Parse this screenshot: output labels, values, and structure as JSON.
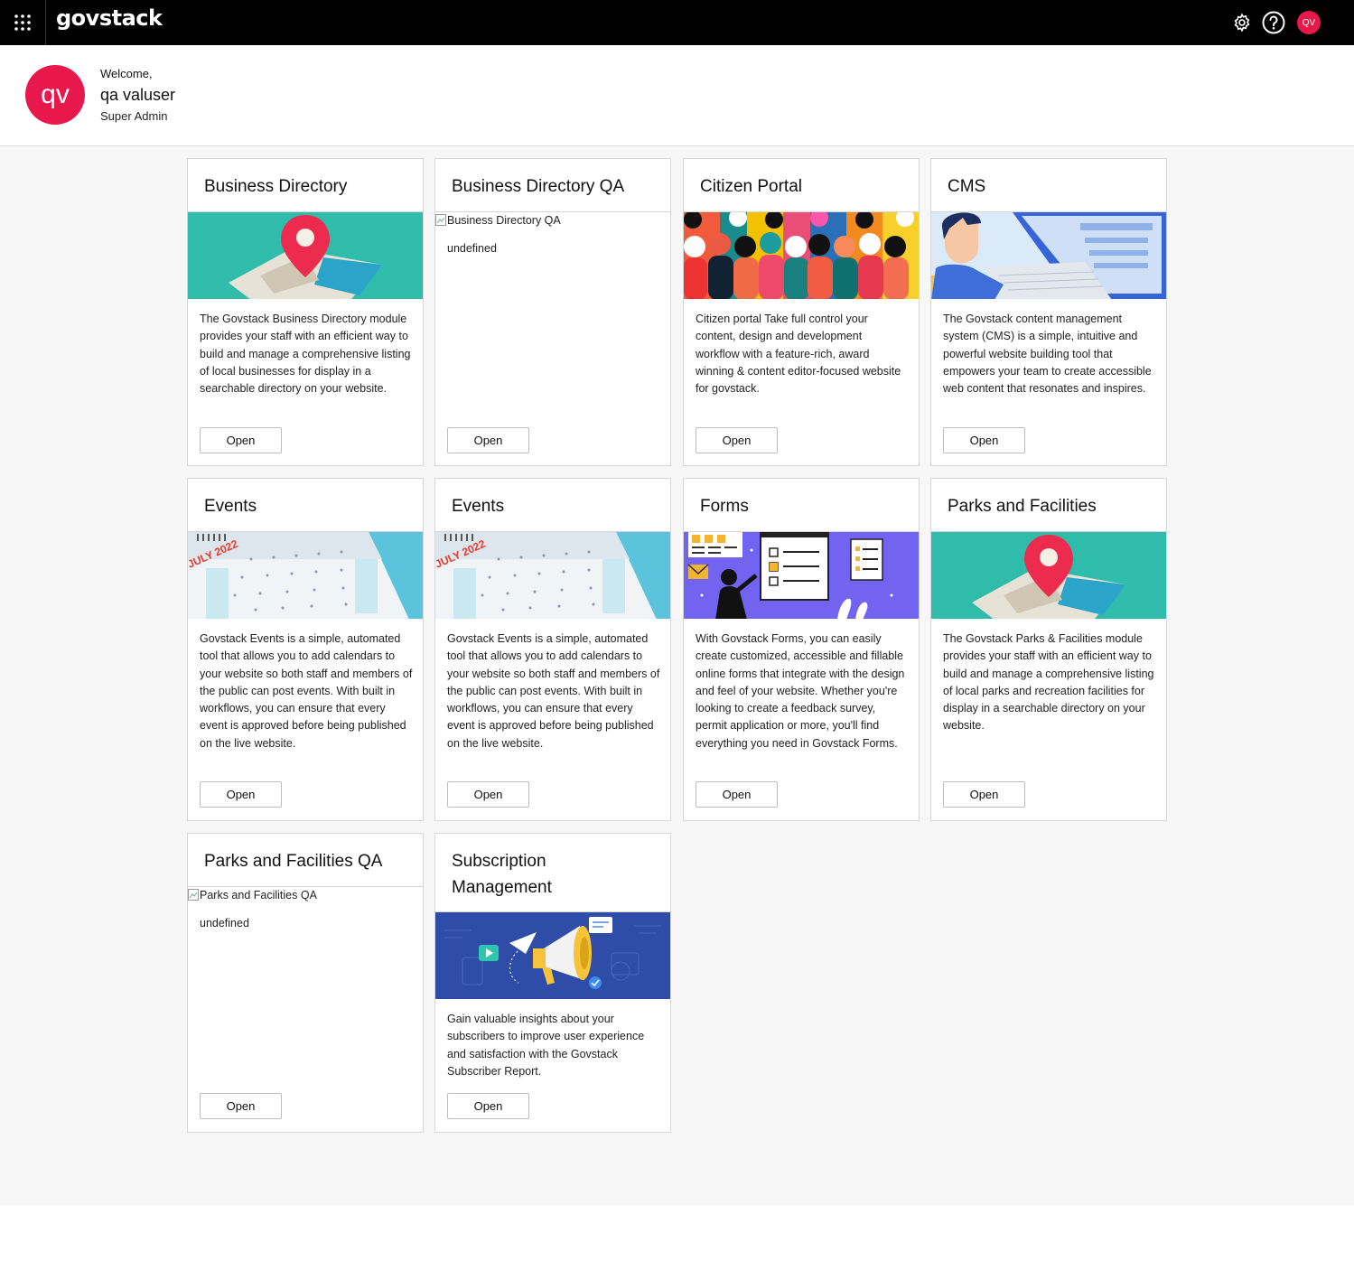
{
  "topbar": {
    "logo": "govstack",
    "avatar_initials": "QV"
  },
  "welcome": {
    "greeting": "Welcome,",
    "name": "qa valuser",
    "role": "Super Admin",
    "avatar_initials": "qv"
  },
  "colors": {
    "brand_red": "#e8174c",
    "teal": "#2fbcaa",
    "forms_purple": "#7264f0",
    "subscription_blue": "#2f4da8"
  },
  "cards": [
    {
      "title": "Business Directory",
      "image": "map-pin-illustration",
      "description": "The Govstack Business Directory module provides your staff with an efficient way to build and manage a comprehensive listing of local businesses for display in a searchable directory on your website.",
      "button": "Open"
    },
    {
      "title": "Business Directory QA",
      "image_alt": "Business Directory QA",
      "description": "undefined",
      "button": "Open"
    },
    {
      "title": "Citizen Portal",
      "image": "people-crowd-illustration",
      "description": "Citizen portal Take full control your content, design and development workflow with a feature-rich, award winning & content editor-focused website for govstack.",
      "button": "Open"
    },
    {
      "title": "CMS",
      "image": "person-at-computer-illustration",
      "description": "The Govstack content management system (CMS) is a simple, intuitive and powerful website building tool that empowers your team to create accessible web content that resonates and inspires.",
      "button": "Open"
    },
    {
      "title": "Events",
      "image": "calendar-illustration",
      "calendar_label": "JULY 2022",
      "description": "Govstack Events is a simple, automated tool that allows you to add calendars to your website so both staff and members of the public can post events. With built in workflows, you can ensure that every event is approved before being published on the live website.",
      "button": "Open"
    },
    {
      "title": "Events",
      "image": "calendar-illustration",
      "calendar_label": "JULY 2022",
      "description": "Govstack Events is a simple, automated tool that allows you to add calendars to your website so both staff and members of the public can post events. With built in workflows, you can ensure that every event is approved before being published on the live website.",
      "button": "Open"
    },
    {
      "title": "Forms",
      "image": "forms-illustration",
      "description": "With Govstack Forms, you can easily create customized, accessible and fillable online forms that integrate with the design and feel of your website. Whether you're looking to create a feedback survey, permit application or more, you'll find everything you need in Govstack Forms.",
      "button": "Open"
    },
    {
      "title": "Parks and Facilities",
      "image": "map-pin-illustration",
      "description": "The Govstack Parks & Facilities module provides your staff with an efficient way to build and manage a comprehensive listing of local parks and recreation facilities for display in a searchable directory on your website.",
      "button": "Open"
    },
    {
      "title": "Parks and Facilities QA",
      "image_alt": "Parks and Facilities QA",
      "description": "undefined",
      "button": "Open"
    },
    {
      "title": "Subscription Management",
      "image": "megaphone-illustration",
      "description": "Gain valuable insights about your subscribers to improve user experience and satisfaction with the Govstack Subscriber Report.",
      "button": "Open"
    }
  ]
}
